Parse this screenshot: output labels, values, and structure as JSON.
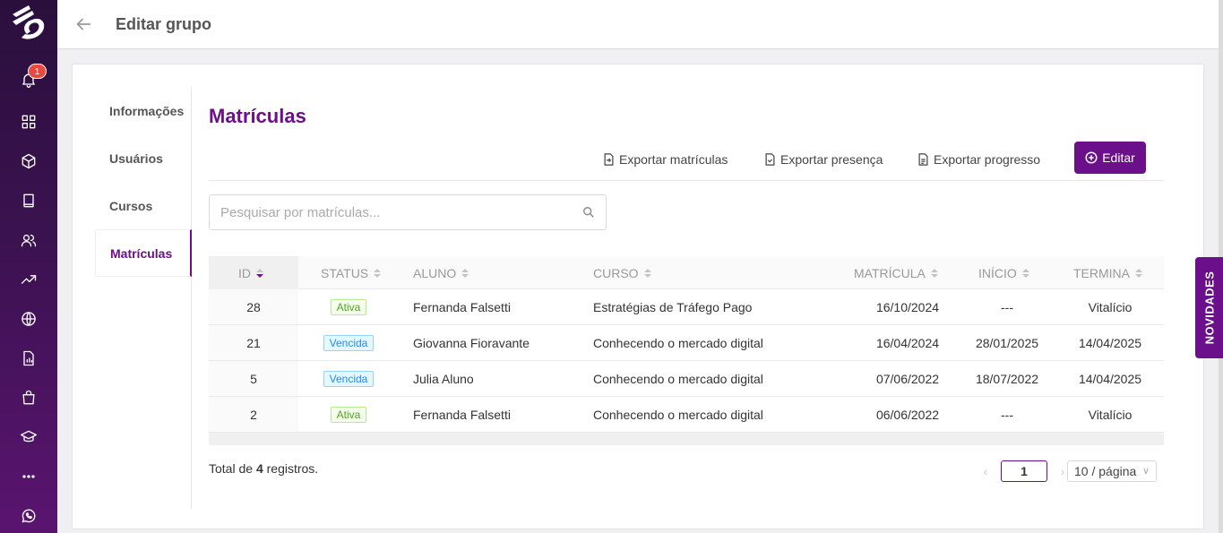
{
  "header": {
    "title": "Editar grupo"
  },
  "notifications": {
    "count": "1"
  },
  "side_menu": {
    "items": [
      {
        "label": "Informações"
      },
      {
        "label": "Usuários"
      },
      {
        "label": "Cursos"
      },
      {
        "label": "Matrículas"
      }
    ],
    "active": "Matrículas"
  },
  "section": {
    "title": "Matrículas"
  },
  "toolbar": {
    "export_enrollments": "Exportar matrículas",
    "export_attendance": "Exportar presença",
    "export_progress": "Exportar progresso",
    "edit": "Editar"
  },
  "search": {
    "placeholder": "Pesquisar por matrículas..."
  },
  "table": {
    "columns": [
      "ID",
      "STATUS",
      "ALUNO",
      "CURSO",
      "MATRÍCULA",
      "INÍCIO",
      "TERMINA"
    ],
    "rows": [
      {
        "id": "28",
        "status": "Ativa",
        "aluno": "Fernanda Falsetti",
        "curso": "Estratégias de Tráfego Pago",
        "matricula": "16/10/2024",
        "inicio": "---",
        "termina": "Vitalício"
      },
      {
        "id": "21",
        "status": "Vencida",
        "aluno": "Giovanna Fioravante",
        "curso": "Conhecendo o mercado digital",
        "matricula": "16/04/2024",
        "inicio": "28/01/2025",
        "termina": "14/04/2025"
      },
      {
        "id": "5",
        "status": "Vencida",
        "aluno": "Julia Aluno",
        "curso": "Conhecendo o mercado digital",
        "matricula": "07/06/2022",
        "inicio": "18/07/2022",
        "termina": "14/04/2025"
      },
      {
        "id": "2",
        "status": "Ativa",
        "aluno": "Fernanda Falsetti",
        "curso": "Conhecendo o mercado digital",
        "matricula": "06/06/2022",
        "inicio": "---",
        "termina": "Vitalício"
      }
    ]
  },
  "footer": {
    "total_prefix": "Total de ",
    "total_count": "4",
    "total_suffix": " registros.",
    "current_page": "1",
    "page_size": "10 / página"
  },
  "novidades": {
    "label": "NOVIDADES"
  },
  "colors": {
    "brand": "#6b0f8a",
    "active_tag": "#52a322",
    "expired_tag": "#1890ff"
  }
}
